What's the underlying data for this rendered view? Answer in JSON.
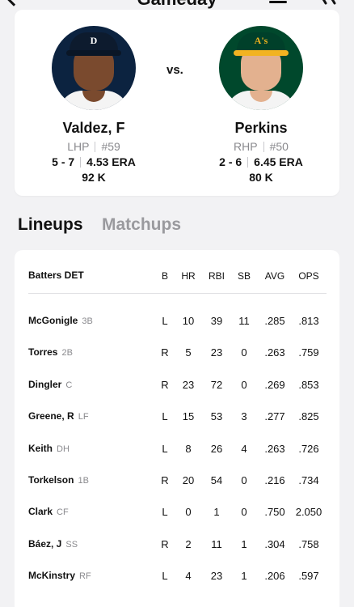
{
  "header": {
    "title": "Gameday"
  },
  "matchup": {
    "vs_label": "vs.",
    "away": {
      "name": "Valdez, F",
      "hand": "LHP",
      "number": "#59",
      "record": "5 - 7",
      "era": "4.53 ERA",
      "strikeouts": "92 K",
      "cap_logo": "D",
      "avatar_bg": "#0c2340"
    },
    "home": {
      "name": "Perkins",
      "hand": "RHP",
      "number": "#50",
      "record": "2 - 6",
      "era": "6.45 ERA",
      "strikeouts": "80 K",
      "cap_logo": "A's",
      "avatar_bg": "#00482c"
    }
  },
  "tabs": [
    {
      "label": "Lineups",
      "active": true
    },
    {
      "label": "Matchups",
      "active": false
    }
  ],
  "lineup": {
    "team_header": "Batters DET",
    "columns": [
      "B",
      "HR",
      "RBI",
      "SB",
      "AVG",
      "OPS"
    ],
    "rows": [
      {
        "name": "McGonigle",
        "pos": "3B",
        "b": "L",
        "hr": "10",
        "rbi": "39",
        "sb": "11",
        "avg": ".285",
        "ops": ".813"
      },
      {
        "name": "Torres",
        "pos": "2B",
        "b": "R",
        "hr": "5",
        "rbi": "23",
        "sb": "0",
        "avg": ".263",
        "ops": ".759"
      },
      {
        "name": "Dingler",
        "pos": "C",
        "b": "R",
        "hr": "23",
        "rbi": "72",
        "sb": "0",
        "avg": ".269",
        "ops": ".853"
      },
      {
        "name": "Greene, R",
        "pos": "LF",
        "b": "L",
        "hr": "15",
        "rbi": "53",
        "sb": "3",
        "avg": ".277",
        "ops": ".825"
      },
      {
        "name": "Keith",
        "pos": "DH",
        "b": "L",
        "hr": "8",
        "rbi": "26",
        "sb": "4",
        "avg": ".263",
        "ops": ".726"
      },
      {
        "name": "Torkelson",
        "pos": "1B",
        "b": "R",
        "hr": "20",
        "rbi": "54",
        "sb": "0",
        "avg": ".216",
        "ops": ".734"
      },
      {
        "name": "Clark",
        "pos": "CF",
        "b": "L",
        "hr": "0",
        "rbi": "1",
        "sb": "0",
        "avg": ".750",
        "ops": "2.050"
      },
      {
        "name": "Báez, J",
        "pos": "SS",
        "b": "R",
        "hr": "2",
        "rbi": "11",
        "sb": "1",
        "avg": ".304",
        "ops": ".758"
      },
      {
        "name": "McKinstry",
        "pos": "RF",
        "b": "L",
        "hr": "4",
        "rbi": "23",
        "sb": "1",
        "avg": ".206",
        "ops": ".597"
      }
    ]
  }
}
